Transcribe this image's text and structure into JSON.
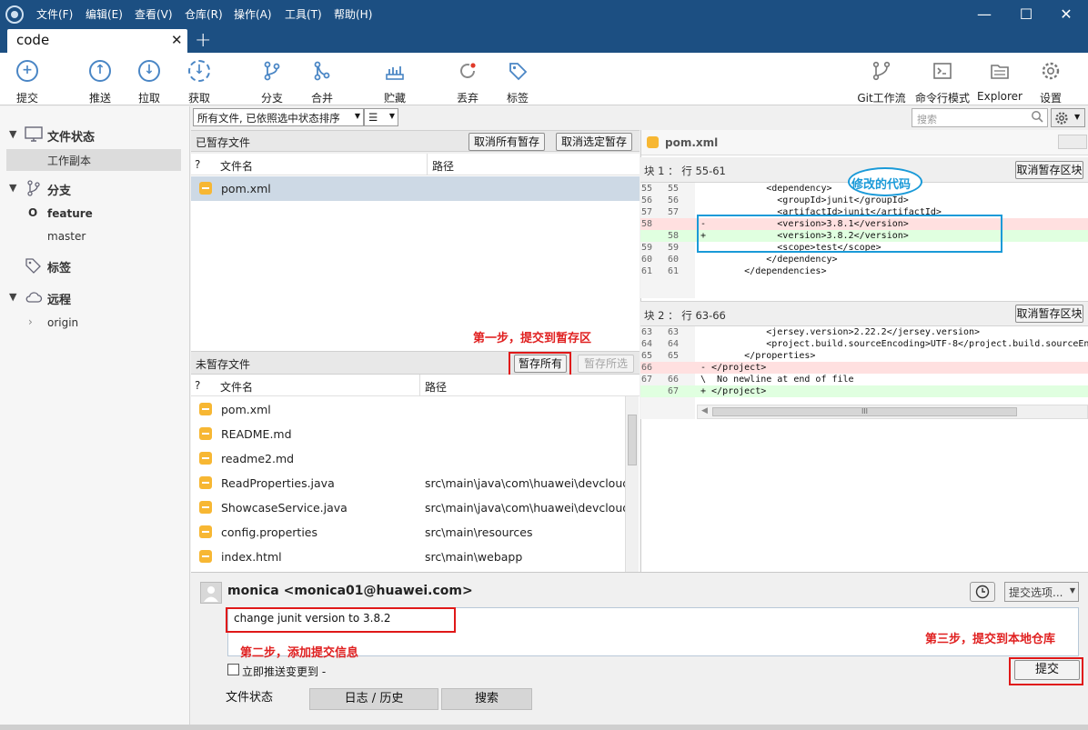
{
  "titlebar": {
    "menus": [
      "文件(F)",
      "编辑(E)",
      "查看(V)",
      "仓库(R)",
      "操作(A)",
      "工具(T)",
      "帮助(H)"
    ],
    "minimize": "—",
    "maximize": "☐",
    "close": "✕"
  },
  "tabs": {
    "active": "code",
    "close": "✕",
    "add": "+"
  },
  "toolbar": {
    "commit": "提交",
    "push": "推送",
    "pull": "拉取",
    "fetch": "获取",
    "branch": "分支",
    "merge": "合并",
    "stash": "贮藏",
    "discard": "丢弃",
    "tag": "标签",
    "gitflow": "Git工作流",
    "terminal": "命令行模式",
    "explorer": "Explorer",
    "settings": "设置"
  },
  "sidebar": {
    "file_status": "文件状态",
    "working_copy": "工作副本",
    "branches": "分支",
    "branch_items": [
      "feature",
      "master"
    ],
    "current_branch_marker": "O",
    "tags": "标签",
    "remotes": "远程",
    "remote_items": [
      "origin"
    ]
  },
  "filter": {
    "sort_option": "所有文件, 已依照选中状态排序",
    "view_icon": "☰",
    "search_placeholder": "搜索"
  },
  "staged": {
    "title": "已暂存文件",
    "unstage_all": "取消所有暂存",
    "unstage_selected": "取消选定暂存",
    "col_status": "?",
    "col_name": "文件名",
    "col_path": "路径",
    "files": [
      {
        "name": "pom.xml",
        "path": ""
      }
    ]
  },
  "unstaged": {
    "title": "未暂存文件",
    "stage_all": "暂存所有",
    "stage_selected": "暂存所选",
    "col_status": "?",
    "col_name": "文件名",
    "col_path": "路径",
    "files": [
      {
        "name": "pom.xml",
        "path": ""
      },
      {
        "name": "README.md",
        "path": ""
      },
      {
        "name": "readme2.md",
        "path": ""
      },
      {
        "name": "ReadProperties.java",
        "path": "src\\main\\java\\com\\huawei\\devcloud"
      },
      {
        "name": "ShowcaseService.java",
        "path": "src\\main\\java\\com\\huawei\\devcloud"
      },
      {
        "name": "config.properties",
        "path": "src\\main\\resources"
      },
      {
        "name": "index.html",
        "path": "src\\main\\webapp"
      }
    ]
  },
  "diff": {
    "file": "pom.xml",
    "hunks": [
      {
        "title": "块 1 ： 行 55-61",
        "button": "取消暂存区块",
        "lines": [
          {
            "a": "55",
            "b": "55",
            "type": "ctx",
            "code": "            <dependency>"
          },
          {
            "a": "56",
            "b": "56",
            "type": "ctx",
            "code": "              <groupId>junit</groupId>"
          },
          {
            "a": "57",
            "b": "57",
            "type": "ctx",
            "code": "              <artifactId>junit</artifactId>"
          },
          {
            "a": "58",
            "b": "",
            "type": "del",
            "code": "-             <version>3.8.1</version>"
          },
          {
            "a": "",
            "b": "58",
            "type": "add",
            "code": "+             <version>3.8.2</version>"
          },
          {
            "a": "59",
            "b": "59",
            "type": "ctx",
            "code": "              <scope>test</scope>"
          },
          {
            "a": "60",
            "b": "60",
            "type": "ctx",
            "code": "            </dependency>"
          },
          {
            "a": "61",
            "b": "61",
            "type": "ctx",
            "code": "        </dependencies>"
          }
        ]
      },
      {
        "title": "块 2 ： 行 63-66",
        "button": "取消暂存区块",
        "lines": [
          {
            "a": "63",
            "b": "63",
            "type": "ctx",
            "code": "            <jersey.version>2.22.2</jersey.version>"
          },
          {
            "a": "64",
            "b": "64",
            "type": "ctx",
            "code": "            <project.build.sourceEncoding>UTF-8</project.build.sourceEnco"
          },
          {
            "a": "65",
            "b": "65",
            "type": "ctx",
            "code": "        </properties>"
          },
          {
            "a": "66",
            "b": "",
            "type": "del",
            "code": "- </project>"
          },
          {
            "a": "67",
            "b": "66",
            "type": "ctx",
            "code": "\\  No newline at end of file"
          },
          {
            "a": "",
            "b": "67",
            "type": "add",
            "code": "+ </project>"
          }
        ]
      }
    ],
    "annotation": "修改的代码",
    "scroll_grip": "III"
  },
  "commit": {
    "author": "monica <monica01@huawei.com>",
    "message": "change junit version to 3.8.2",
    "options": "提交选项...",
    "push_label": "立即推送变更到 -",
    "submit": "提交"
  },
  "notes": {
    "step1": "第一步，提交到暂存区",
    "step2": "第二步，添加提交信息",
    "step3": "第三步，提交到本地仓库"
  },
  "bottom_tabs": [
    "文件状态",
    "日志 / 历史",
    "搜索"
  ]
}
